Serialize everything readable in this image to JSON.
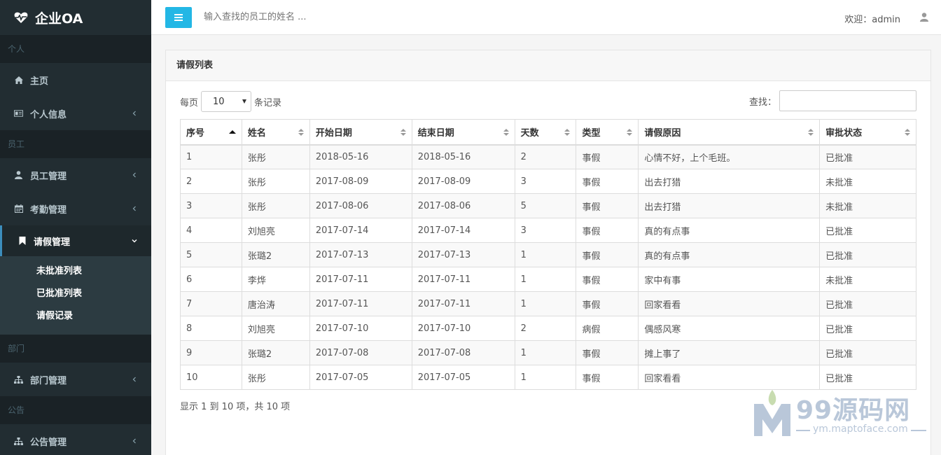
{
  "brand": {
    "name": "企业OA"
  },
  "header": {
    "search_placeholder": "输入查找的员工的姓名 ...",
    "welcome": "欢迎：admin"
  },
  "sidebar": {
    "sections": [
      "个人",
      "员工",
      "部门",
      "公告"
    ],
    "items": {
      "home": "主页",
      "profile": "个人信息",
      "employees": "员工管理",
      "attendance": "考勤管理",
      "leave": "请假管理",
      "departments": "部门管理",
      "notices": "公告管理"
    },
    "leave_sub": [
      "未批准列表",
      "已批准列表",
      "请假记录"
    ]
  },
  "panel": {
    "title": "请假列表",
    "perpage_prefix": "每页",
    "perpage_value": "10",
    "perpage_suffix": "条记录",
    "search_label": "查找：",
    "info": "显示 1 到 10 项，共 10 项"
  },
  "table": {
    "columns": [
      "序号",
      "姓名",
      "开始日期",
      "结束日期",
      "天数",
      "类型",
      "请假原因",
      "审批状态"
    ],
    "rows": [
      [
        "1",
        "张彤",
        "2018-05-16",
        "2018-05-16",
        "2",
        "事假",
        "心情不好，上个毛班。",
        "已批准"
      ],
      [
        "2",
        "张彤",
        "2017-08-09",
        "2017-08-09",
        "3",
        "事假",
        "出去打猎",
        "未批准"
      ],
      [
        "3",
        "张彤",
        "2017-08-06",
        "2017-08-06",
        "5",
        "事假",
        "出去打猎",
        "未批准"
      ],
      [
        "4",
        "刘旭亮",
        "2017-07-14",
        "2017-07-14",
        "3",
        "事假",
        "真的有点事",
        "已批准"
      ],
      [
        "5",
        "张璐2",
        "2017-07-13",
        "2017-07-13",
        "1",
        "事假",
        "真的有点事",
        "已批准"
      ],
      [
        "6",
        "李烨",
        "2017-07-11",
        "2017-07-11",
        "1",
        "事假",
        "家中有事",
        "未批准"
      ],
      [
        "7",
        "唐治涛",
        "2017-07-11",
        "2017-07-11",
        "1",
        "事假",
        "回家看看",
        "已批准"
      ],
      [
        "8",
        "刘旭亮",
        "2017-07-10",
        "2017-07-10",
        "2",
        "病假",
        "偶感风寒",
        "已批准"
      ],
      [
        "9",
        "张璐2",
        "2017-07-08",
        "2017-07-08",
        "1",
        "事假",
        "摊上事了",
        "已批准"
      ],
      [
        "10",
        "张彤",
        "2017-07-05",
        "2017-07-05",
        "1",
        "事假",
        "回家看看",
        "已批准"
      ]
    ]
  },
  "watermark": {
    "big": "99源码网",
    "small": "ym.maptoface.com"
  },
  "colors": {
    "sidebar": "#222d32",
    "accent": "#23b7e5",
    "active_border": "#3c8dbc"
  }
}
